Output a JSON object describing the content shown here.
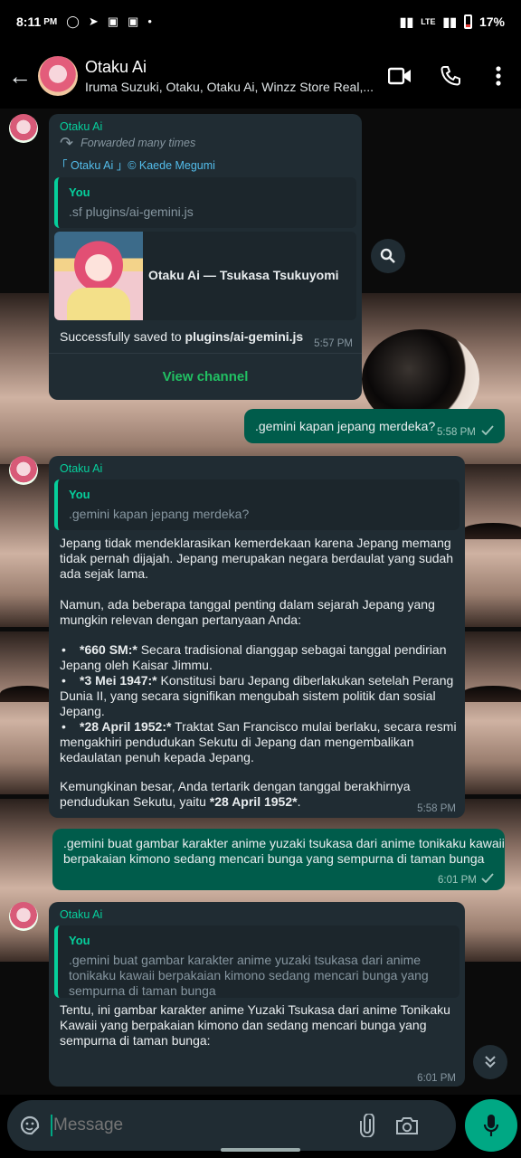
{
  "status": {
    "time": "8:11",
    "ampm": "PM",
    "battery": "17%",
    "network": "LTE"
  },
  "header": {
    "title": "Otaku Ai",
    "subtitle": "Iruma Suzuki, Otaku, Otaku Ai, Winzz Store Real,..."
  },
  "messages": {
    "m1": {
      "sender": "Otaku Ai",
      "forwarded": "Forwarded many times",
      "channel_tag": "「 Otaku Ai 」© Kaede Megumi",
      "quote_name": "You",
      "quote_text": ".sf plugins/ai-gemini.js",
      "preview_title": "Otaku Ai — Tsukasa Tsukuyomi",
      "body_prefix": "Successfully saved to ",
      "body_bold": "plugins/ai-gemini.js",
      "time": "5:57 PM",
      "action": "View channel"
    },
    "m2": {
      "text": ".gemini kapan jepang merdeka?",
      "time": "5:58 PM"
    },
    "m3": {
      "sender": "Otaku Ai",
      "quote_name": "You",
      "quote_text": ".gemini kapan jepang merdeka?",
      "p1": "Jepang tidak mendeklarasikan kemerdekaan karena Jepang memang\ntidak pernah dijajah. Jepang merupakan negara berdaulat yang sudah\nada sejak lama.",
      "p2": "Namun, ada beberapa tanggal penting dalam sejarah Jepang yang\nmungkin relevan dengan pertanyaan Anda:",
      "b1_bold": "*660 SM:*",
      "b1_text": " Secara tradisional dianggap sebagai tanggal pendirian\nJepang oleh Kaisar Jimmu.",
      "b2_bold": "*3 Mei 1947:*",
      "b2_text": " Konstitusi baru Jepang diberlakukan setelah Perang\nDunia II, yang secara signifikan mengubah sistem politik dan sosial\nJepang.",
      "b3_bold": "*28 April 1952:*",
      "b3_text": " Traktat San Francisco mulai berlaku, secara resmi\nmengakhiri pendudukan Sekutu di Jepang dan mengembalikan\nkedaulatan penuh kepada Jepang.",
      "p3": "Kemungkinan besar, Anda tertarik dengan tanggal berakhirnya\npendudukan Sekutu, yaitu ",
      "p3_bold": "*28 April 1952*",
      "p3_end": ".",
      "time": "5:58 PM"
    },
    "m4": {
      "text": ".gemini buat gambar karakter anime yuzaki tsukasa dari anime tonikaku kawaii\nberpakaian kimono sedang mencari bunga yang sempurna di taman bunga",
      "time": "6:01 PM"
    },
    "m5": {
      "sender": "Otaku Ai",
      "quote_name": "You",
      "quote_text": ".gemini buat gambar karakter anime yuzaki tsukasa dari anime\ntonikaku kawaii berpakaian kimono sedang mencari bunga yang\nsempurna di taman bunga",
      "text": "Tentu, ini gambar karakter anime Yuzaki Tsukasa dari anime Tonikaku\nKawaii yang berpakaian kimono dan sedang mencari bunga yang\nsempurna di taman bunga:",
      "time": "6:01 PM"
    }
  },
  "composer": {
    "placeholder": "Message"
  },
  "colors": {
    "accent": "#00a884",
    "incoming": "#202c33",
    "outgoing": "#005c4b",
    "sender": "#06cf9c"
  }
}
